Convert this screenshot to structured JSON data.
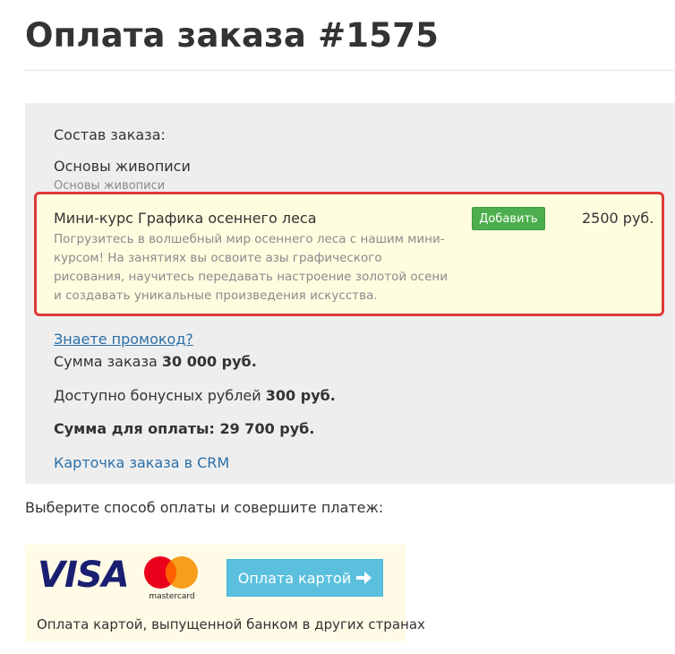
{
  "page": {
    "title": "Оплата заказа #1575"
  },
  "order": {
    "composition_label": "Состав заказа:",
    "item": {
      "name": "Основы живописи",
      "subtitle": "Основы живописи"
    },
    "upsell": {
      "title": "Мини-курс Графика осеннего леса",
      "description": "Погрузитесь в волшебный мир осеннего леса с нашим мини-курсом! На занятиях вы освоите азы графического рисования, научитесь передавать настроение золотой осени и создавать уникальные произведения искусства.",
      "add_button": "Добавить",
      "price": "2500 руб."
    },
    "promo_link": "Знаете промокод?",
    "sum_label": "Сумма заказа",
    "sum_value": "30 000 руб.",
    "bonus_label": "Доступно бонусных рублей",
    "bonus_value": "300 руб.",
    "pay_label": "Сумма для оплаты:",
    "pay_value": "29 700 руб.",
    "crm_link": "Карточка заказа в CRM"
  },
  "payment": {
    "prompt": "Выберите способ оплаты и совершите платеж:",
    "visa_logo": "VISA",
    "mastercard_logo": "mastercard",
    "card_button": "Оплата картой",
    "card_button_icon": "arrow-right-icon",
    "card_note": "Оплата картой, выпущенной банком в других странах"
  },
  "colors": {
    "link": "#2a6fa8",
    "highlight_border": "#e03a3a",
    "add_button": "#4cae4c",
    "card_button": "#5bc0de",
    "visa_blue": "#1a1f71"
  }
}
